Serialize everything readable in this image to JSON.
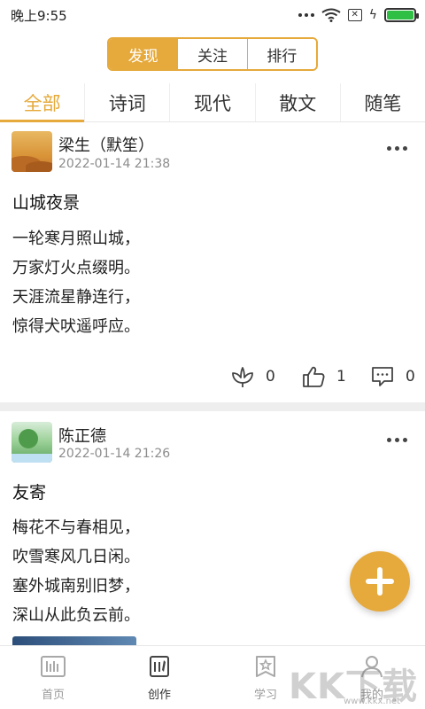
{
  "status_bar": {
    "time": "晚上9:55"
  },
  "top_segments": [
    {
      "label": "发现",
      "active": true
    },
    {
      "label": "关注",
      "active": false
    },
    {
      "label": "排行",
      "active": false
    }
  ],
  "category_tabs": [
    {
      "label": "全部",
      "active": true
    },
    {
      "label": "诗词",
      "active": false
    },
    {
      "label": "现代",
      "active": false
    },
    {
      "label": "散文",
      "active": false
    },
    {
      "label": "随笔",
      "active": false
    }
  ],
  "posts": [
    {
      "author": "梁生（默笙）",
      "date": "2022-01-14 21:38",
      "title": "山城夜景",
      "lines": [
        "一轮寒月照山城，",
        "万家灯火点缀明。",
        "天涯流星静连行，",
        "惊得犬吠遥呼应。"
      ],
      "flowers": "0",
      "likes": "1",
      "comments": "0"
    },
    {
      "author": "陈正德",
      "date": "2022-01-14 21:26",
      "title": "友寄",
      "lines": [
        "梅花不与春相见，",
        "吹雪寒风几日闲。",
        "塞外城南别旧梦，",
        "深山从此负云前。"
      ]
    }
  ],
  "bottom_nav": [
    {
      "label": "首页",
      "icon": "home-icon",
      "active": false
    },
    {
      "label": "创作",
      "icon": "create-icon",
      "active": true
    },
    {
      "label": "学习",
      "icon": "study-icon",
      "active": false
    },
    {
      "label": "我的",
      "icon": "profile-icon",
      "active": false
    }
  ],
  "watermark": {
    "text": "KK下载",
    "url": "www.kkx.net"
  },
  "colors": {
    "accent": "#e6a93b",
    "battery": "#2fbf44"
  }
}
